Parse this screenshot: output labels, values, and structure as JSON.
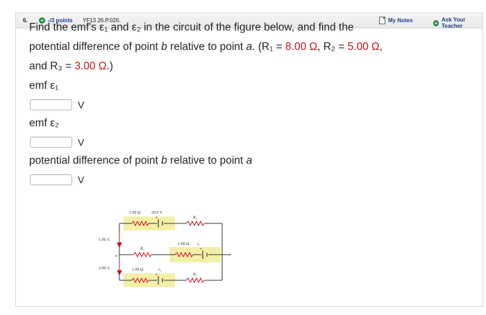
{
  "header": {
    "question_number": "6.",
    "points": "-/3 points",
    "problem_code": "YF13 26.P.026.",
    "my_notes": "My Notes",
    "ask_teacher": "Ask Your Teacher"
  },
  "question": {
    "line1": "Find the emf's ε₁ and ε₂ in the circuit of the figure below, and find the",
    "line2_prefix": "potential difference of point ",
    "line2_b": "b",
    "line2_mid": " relative to point ",
    "line2_a": "a",
    "line2_r1_label": ". (R₁ = ",
    "r1_value": "8.00 Ω",
    "line2_r2_label": ", R₂ = ",
    "r2_value": "5.00 Ω",
    "line2_end": ",",
    "line3_prefix": "and R₃ = ",
    "r3_value": "3.00 Ω",
    "line3_end": ".)"
  },
  "answers": [
    {
      "label": "emf ε₁",
      "unit": "V"
    },
    {
      "label": "emf ε₂",
      "unit": "V"
    },
    {
      "label_prefix": "potential difference of point ",
      "label_b": "b",
      "label_mid": " relative to point ",
      "label_a": "a",
      "unit": "V"
    }
  ],
  "figure": {
    "top_resistor": "1.00 Ω",
    "top_emf": "20.0 V",
    "r1": "R₁",
    "current_1": "1.00 A",
    "mid_resistor": "1.00 Ω",
    "eps1": "ε₁",
    "r2": "R₂",
    "point_a": "a",
    "point_b": "b",
    "current_2": "2.00 A",
    "bottom_resistor": "1.00 Ω",
    "eps2": "ε₂",
    "r3": "R₃"
  }
}
